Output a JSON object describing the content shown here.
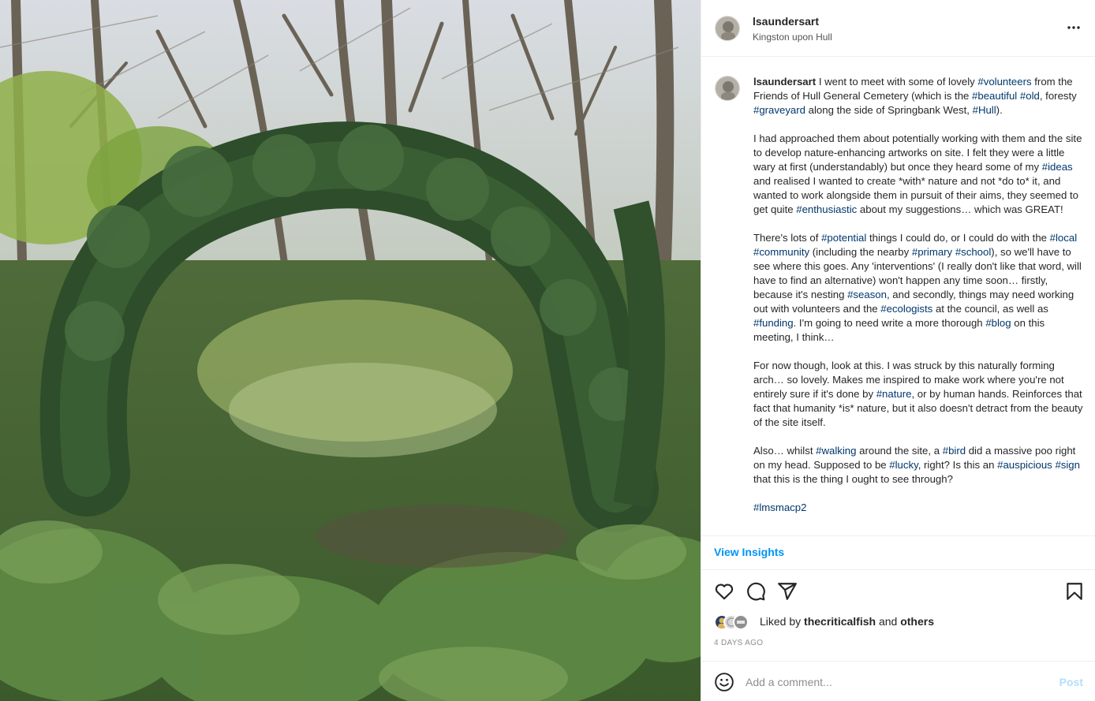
{
  "photo": {
    "icon": "forest-ivy-arch-photo"
  },
  "header": {
    "username": "lsaundersart",
    "location": "Kingston upon Hull",
    "more_icon": "more-horizontal-icon"
  },
  "caption": {
    "username": "lsaundersart",
    "p1": {
      "t1": " I went to meet with some of lovely ",
      "h1": "#volunteers",
      "t2": " from the Friends of Hull General Cemetery (which is the ",
      "h2": "#beautiful",
      "t3": " ",
      "h3": "#old",
      "t4": ", foresty ",
      "h4": "#graveyard",
      "t5": " along the side of Springbank West, ",
      "h5": "#Hull",
      "t6": ")."
    },
    "p2": {
      "t1": "I had approached them about potentially working with them and the site to develop nature-enhancing artworks on site. I felt they were a little wary at first (understandably) but once they heard some of my ",
      "h1": "#ideas",
      "t2": " and realised I wanted to create *with* nature and not *do to* it, and wanted to work alongside them in pursuit of their aims, they seemed to get quite ",
      "h2": "#enthusiastic",
      "t3": " about my suggestions… which was GREAT!"
    },
    "p3": {
      "t1": "There's lots of ",
      "h1": "#potential",
      "t2": " things I could do, or I could do with the ",
      "h2": "#local",
      "t3": " ",
      "h3": "#community",
      "t4": " (including the nearby ",
      "h4": "#primary",
      "t5": " ",
      "h5": "#school",
      "t6": "), so we'll have to see where this goes. Any 'interventions' (I really don't like that word, will have to find an alternative) won't happen any time soon… firstly, because it's nesting ",
      "h6": "#season",
      "t7": ", and secondly, things may need working out with volunteers and the ",
      "h7": "#ecologists",
      "t8": " at the council, as well as ",
      "h8": "#funding",
      "t9": ". I'm going to need write a more thorough ",
      "h9": "#blog",
      "t10": " on this meeting, I think…"
    },
    "p4": {
      "t1": "For now though, look at this. I was struck by this naturally forming arch… so lovely. Makes me inspired to make work where you're not entirely sure if it's done by ",
      "h1": "#nature",
      "t2": ", or by human hands. Reinforces that fact that humanity *is* nature, but it also doesn't detract from the beauty of the site itself."
    },
    "p5": {
      "t1": "Also… whilst ",
      "h1": "#walking",
      "t2": " around the site, a ",
      "h2": "#bird",
      "t3": " did a massive poo right on my head. Supposed to be ",
      "h3": "#lucky",
      "t4": ", right? Is this an ",
      "h4": "#auspicious",
      "t5": " ",
      "h5": "#sign",
      "t6": " that this is the thing I ought to see through?"
    },
    "p6": {
      "h1": "#lmsmacp2"
    }
  },
  "insights_label": "View Insights",
  "actions": {
    "like_icon": "heart-icon",
    "comment_icon": "comment-bubble-icon",
    "share_icon": "paper-plane-icon",
    "save_icon": "bookmark-icon"
  },
  "likes": {
    "prefix": "Liked by ",
    "user": "thecriticalfish",
    "middle": " and ",
    "others": "others"
  },
  "timestamp": "4 DAYS AGO",
  "comment": {
    "emoji_icon": "smiley-icon",
    "placeholder": "Add a comment...",
    "post_label": "Post"
  },
  "colors": {
    "hashtag": "#00376b",
    "insights": "#0095f6",
    "post_disabled": "#b2dffc",
    "muted": "#8e8e8e"
  }
}
